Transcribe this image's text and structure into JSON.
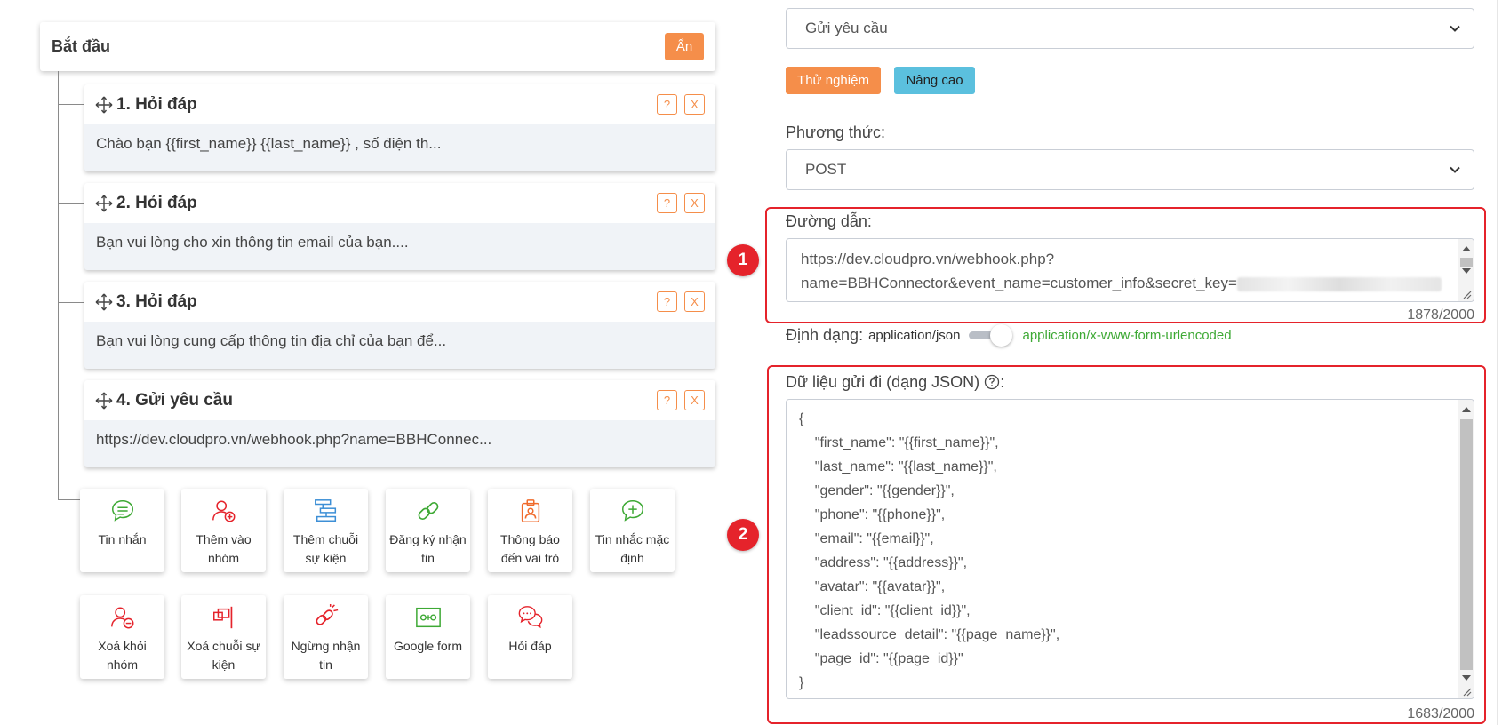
{
  "flow": {
    "start_title": "Bắt đầu",
    "hide_label": "Ẩn",
    "help_label": "?",
    "remove_label": "X",
    "steps": [
      {
        "title": "1. Hỏi đáp",
        "preview": "Chào bạn {{first_name}} {{last_name}} , số điện th..."
      },
      {
        "title": "2. Hỏi đáp",
        "preview": "Bạn vui lòng cho xin thông tin email của bạn...."
      },
      {
        "title": "3. Hỏi đáp",
        "preview": "Bạn vui lòng cung cấp thông tin địa chỉ của bạn để..."
      },
      {
        "title": "4. Gửi yêu cầu",
        "preview": "https://dev.cloudpro.vn/webhook.php?name=BBHConnec..."
      }
    ],
    "actions": [
      {
        "label": "Tin nhắn",
        "icon": "message-icon",
        "color": "#3ea935"
      },
      {
        "label": "Thêm vào nhóm",
        "icon": "add-user-icon",
        "color": "#e5232b"
      },
      {
        "label": "Thêm chuỗi sự kiện",
        "icon": "sequence-icon",
        "color": "#3d8fd6"
      },
      {
        "label": "Đăng ký nhận tin",
        "icon": "link-icon",
        "color": "#3ea935"
      },
      {
        "label": "Thông báo đến vai trò",
        "icon": "badge-icon",
        "color": "#f06b2c"
      },
      {
        "label": "Tin nhắc mặc định",
        "icon": "message-plus-icon",
        "color": "#3ea935"
      },
      {
        "label": "Xoá khỏi nhóm",
        "icon": "remove-user-icon",
        "color": "#e5232b"
      },
      {
        "label": "Xoá chuỗi sự kiện",
        "icon": "flag-remove-icon",
        "color": "#e5232b"
      },
      {
        "label": "Ngừng nhận tin",
        "icon": "unsubscribe-icon",
        "color": "#e5232b"
      },
      {
        "label": "Google form",
        "icon": "form-icon",
        "color": "#3ea935"
      },
      {
        "label": "Hỏi đáp",
        "icon": "chat-icon",
        "color": "#e5232b"
      }
    ]
  },
  "form": {
    "action_type": "Gửi yêu cầu",
    "test_label": "Thử nghiệm",
    "advanced_label": "Nâng cao",
    "method_label": "Phương thức:",
    "method_value": "POST",
    "url_label": "Đường dẫn:",
    "url_line1": "https://dev.cloudpro.vn/webhook.php?",
    "url_line2": "name=BBHConnector&event_name=customer_info&secret_key=",
    "url_count": "1878/2000",
    "format_label": "Định dạng:",
    "format_off": "application/json",
    "format_on": "application/x-www-form-urlencoded",
    "payload_label": "Dữ liệu gửi đi (dạng JSON)",
    "payload_label_suffix": ":",
    "payload_lines": [
      "{",
      "    \"first_name\": \"{{first_name}}\",",
      "    \"last_name\": \"{{last_name}}\",",
      "    \"gender\": \"{{gender}}\",",
      "    \"phone\": \"{{phone}}\",",
      "    \"email\": \"{{email}}\",",
      "    \"address\": \"{{address}}\",",
      "    \"avatar\": \"{{avatar}}\",",
      "    \"client_id\": \"{{client_id}}\",",
      "    \"leadssource_detail\": \"{{page_name}}\",",
      "    \"page_id\": \"{{page_id}}\"",
      "}"
    ],
    "payload_count": "1683/2000"
  },
  "annotations": {
    "marker1": "1",
    "marker2": "2"
  },
  "colors": {
    "accent_orange": "#f58e4a",
    "accent_blue": "#5bc0de",
    "highlight_red": "#e5232b",
    "success_green": "#3ea935"
  }
}
